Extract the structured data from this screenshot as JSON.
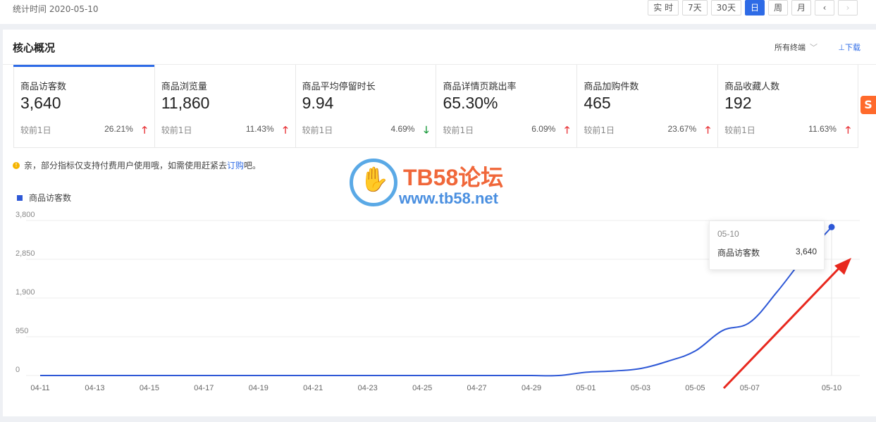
{
  "header": {
    "stat_time": "统计时间 2020-05-10",
    "ranges": [
      {
        "label": "实 时",
        "active": false
      },
      {
        "label": "7天",
        "active": false
      },
      {
        "label": "30天",
        "active": false
      },
      {
        "label": "日",
        "active": true
      },
      {
        "label": "周",
        "active": false
      },
      {
        "label": "月",
        "active": false
      }
    ],
    "prev_icon": "chevron-left-icon",
    "next_icon": "chevron-right-icon"
  },
  "card": {
    "title": "核心概况",
    "terminal_label": "所有终端",
    "download_label": "⊥下载"
  },
  "metrics": [
    {
      "label": "商品访客数",
      "value": "3,640",
      "compare": "较前1日",
      "change": "26.21%",
      "direction": "up"
    },
    {
      "label": "商品浏览量",
      "value": "11,860",
      "compare": "较前1日",
      "change": "11.43%",
      "direction": "up"
    },
    {
      "label": "商品平均停留时长",
      "value": "9.94",
      "compare": "较前1日",
      "change": "4.69%",
      "direction": "down"
    },
    {
      "label": "商品详情页跳出率",
      "value": "65.30%",
      "compare": "较前1日",
      "change": "6.09%",
      "direction": "up"
    },
    {
      "label": "商品加购件数",
      "value": "465",
      "compare": "较前1日",
      "change": "23.67%",
      "direction": "up"
    },
    {
      "label": "商品收藏人数",
      "value": "192",
      "compare": "较前1日",
      "change": "11.63%",
      "direction": "up"
    }
  ],
  "notice": {
    "text_before": "亲，部分指标仅支持付费用户使用哦，如需使用赶紧去",
    "link": "订购",
    "text_after": "吧。"
  },
  "watermark": {
    "line1": "TB58论坛",
    "line2": "www.tb58.net"
  },
  "tooltip": {
    "date": "05-10",
    "name": "商品访客数",
    "value": "3,640"
  },
  "colors": {
    "accent": "#2e6be6",
    "line": "#2e58d6",
    "up": "#e8363a",
    "down": "#1a9a3c",
    "annotation_arrow": "#e8281e"
  },
  "chart_data": {
    "type": "line",
    "series": [
      {
        "name": "商品访客数",
        "x": [
          "04-11",
          "04-12",
          "04-13",
          "04-14",
          "04-15",
          "04-16",
          "04-17",
          "04-18",
          "04-19",
          "04-20",
          "04-21",
          "04-22",
          "04-23",
          "04-24",
          "04-25",
          "04-26",
          "04-27",
          "04-28",
          "04-29",
          "04-30",
          "05-01",
          "05-02",
          "05-03",
          "05-04",
          "05-05",
          "05-06",
          "05-07",
          "05-08",
          "05-09",
          "05-10"
        ],
        "values": [
          0,
          0,
          0,
          0,
          0,
          0,
          0,
          0,
          0,
          0,
          0,
          0,
          0,
          0,
          0,
          0,
          0,
          0,
          0,
          0,
          80,
          110,
          170,
          350,
          600,
          1100,
          1300,
          2050,
          2900,
          3640
        ]
      }
    ],
    "x_ticks": [
      "04-11",
      "04-13",
      "04-15",
      "04-17",
      "04-19",
      "04-21",
      "04-23",
      "04-25",
      "04-27",
      "04-29",
      "05-01",
      "05-03",
      "05-05",
      "05-07",
      "05-10"
    ],
    "y_ticks": [
      "3,800",
      "2,850",
      "1,900",
      "950",
      "0"
    ],
    "ylim": [
      0,
      3800
    ],
    "grid": true,
    "highlight": "05-10"
  }
}
